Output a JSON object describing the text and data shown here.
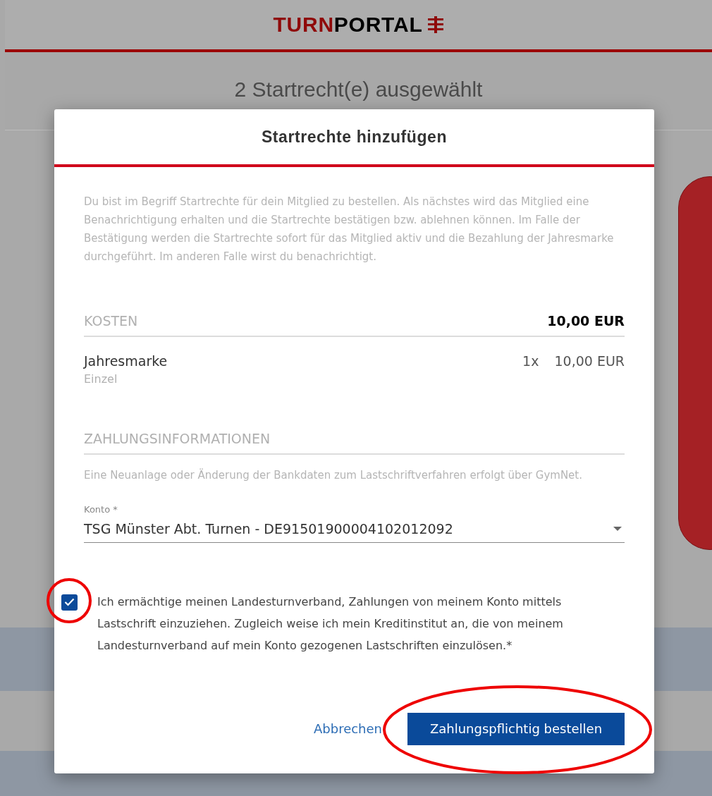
{
  "header": {
    "logo": {
      "accent": "TURN",
      "rest": "PORTAL"
    }
  },
  "page": {
    "subtitle": "2 Startrecht(e) ausgewählt"
  },
  "dialog": {
    "title": "Startrechte hinzufügen",
    "intro": "Du bist im Begriff Startrechte für dein Mitglied zu bestellen. Als nächstes wird das Mitglied eine Benachrichtigung erhalten und die Startrechte bestätigen bzw. ablehnen können. Im Falle der Bestätigung werden die Startrechte sofort für das Mitglied aktiv und die Bezahlung der Jahresmarke durchgeführt. Im anderen Falle wirst du benachrichtigt.",
    "costs": {
      "heading": "KOSTEN",
      "total": "10,00 EUR",
      "items": [
        {
          "name": "Jahresmarke",
          "detail": "Einzel",
          "quantity": "1x",
          "price": "10,00 EUR"
        }
      ]
    },
    "payment": {
      "heading": "ZAHLUNGSINFORMATIONEN",
      "info": "Eine Neuanlage oder Änderung der Bankdaten zum Lastschriftverfahren erfolgt über GymNet.",
      "account": {
        "label": "Konto *",
        "value": "TSG Münster Abt. Turnen - DE91501900004102012092"
      },
      "mandate": {
        "checked": true,
        "text": "Ich ermächtige meinen Landesturnverband, Zahlungen von meinem Konto mittels Lastschrift einzuziehen. Zugleich weise ich mein Kreditinstitut an, die von meinem Landesturnverband auf mein Konto gezogenen Lastschriften einzulösen.*"
      }
    },
    "buttons": [
      {
        "label": "Abbrechen",
        "kind": "text"
      },
      {
        "label": "Zahlungspflichtig bestellen",
        "kind": "primary"
      }
    ]
  }
}
